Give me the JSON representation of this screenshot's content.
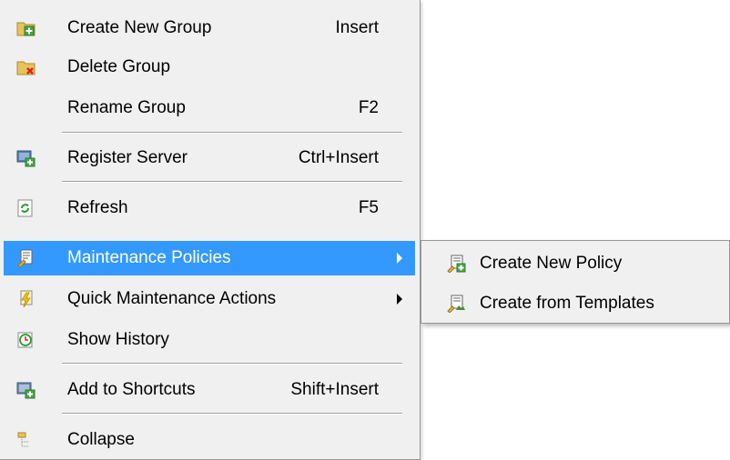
{
  "main_menu": {
    "items": [
      {
        "label": "Create New Group",
        "shortcut": "Insert",
        "icon": "folder-add-icon"
      },
      {
        "label": "Delete Group",
        "shortcut": "",
        "icon": "folder-delete-icon"
      },
      {
        "label": "Rename Group",
        "shortcut": "F2",
        "icon": ""
      },
      {
        "label": "Register Server",
        "shortcut": "Ctrl+Insert",
        "icon": "server-add-icon"
      },
      {
        "label": "Refresh",
        "shortcut": "F5",
        "icon": "refresh-icon"
      },
      {
        "label": "Maintenance Policies",
        "shortcut": "",
        "icon": "policy-icon",
        "selected": true,
        "submenu": true
      },
      {
        "label": "Quick Maintenance Actions",
        "shortcut": "",
        "icon": "quick-actions-icon",
        "submenu": true
      },
      {
        "label": "Show History",
        "shortcut": "",
        "icon": "history-icon"
      },
      {
        "label": "Add to Shortcuts",
        "shortcut": "Shift+Insert",
        "icon": "shortcut-add-icon"
      },
      {
        "label": "Collapse",
        "shortcut": "",
        "icon": "collapse-tree-icon"
      }
    ]
  },
  "sub_menu": {
    "items": [
      {
        "label": "Create New Policy",
        "icon": "policy-add-icon"
      },
      {
        "label": "Create from Templates",
        "icon": "template-policy-icon"
      }
    ]
  },
  "colors": {
    "menu_bg": "#f0f0f0",
    "highlight": "#3399ff",
    "border": "#979797",
    "text": "#000000"
  }
}
